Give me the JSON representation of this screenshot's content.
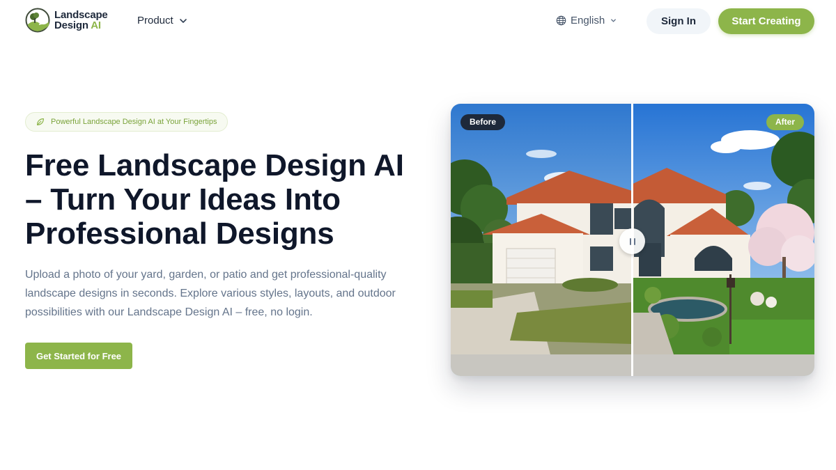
{
  "brand": {
    "name_line1": "Landscape",
    "name_line2": "Design",
    "name_accent": "AI",
    "accent_color": "#8db54a"
  },
  "nav": {
    "product_label": "Product",
    "language_label": "English",
    "signin_label": "Sign In",
    "start_label": "Start Creating"
  },
  "hero": {
    "pill_text": "Powerful Landscape Design AI at Your Fingertips",
    "headline": "Free Landscape Design AI – Turn Your Ideas Into Professional Designs",
    "description": "Upload a photo of your yard, garden, or patio and get professional-quality landscape designs in seconds. Explore various styles, layouts, and outdoor possibilities with our Landscape Design AI – free, no login.",
    "cta_label": "Get Started for Free"
  },
  "compare": {
    "before_label": "Before",
    "after_label": "After",
    "slider_position": 0.5
  },
  "icons": {
    "logo": "landscape-logo-icon",
    "product_chevron": "chevron-down-icon",
    "language": "globe-icon",
    "language_chevron": "chevron-down-icon",
    "pill": "leaf-icon",
    "slider": "slider-handle-icon"
  }
}
